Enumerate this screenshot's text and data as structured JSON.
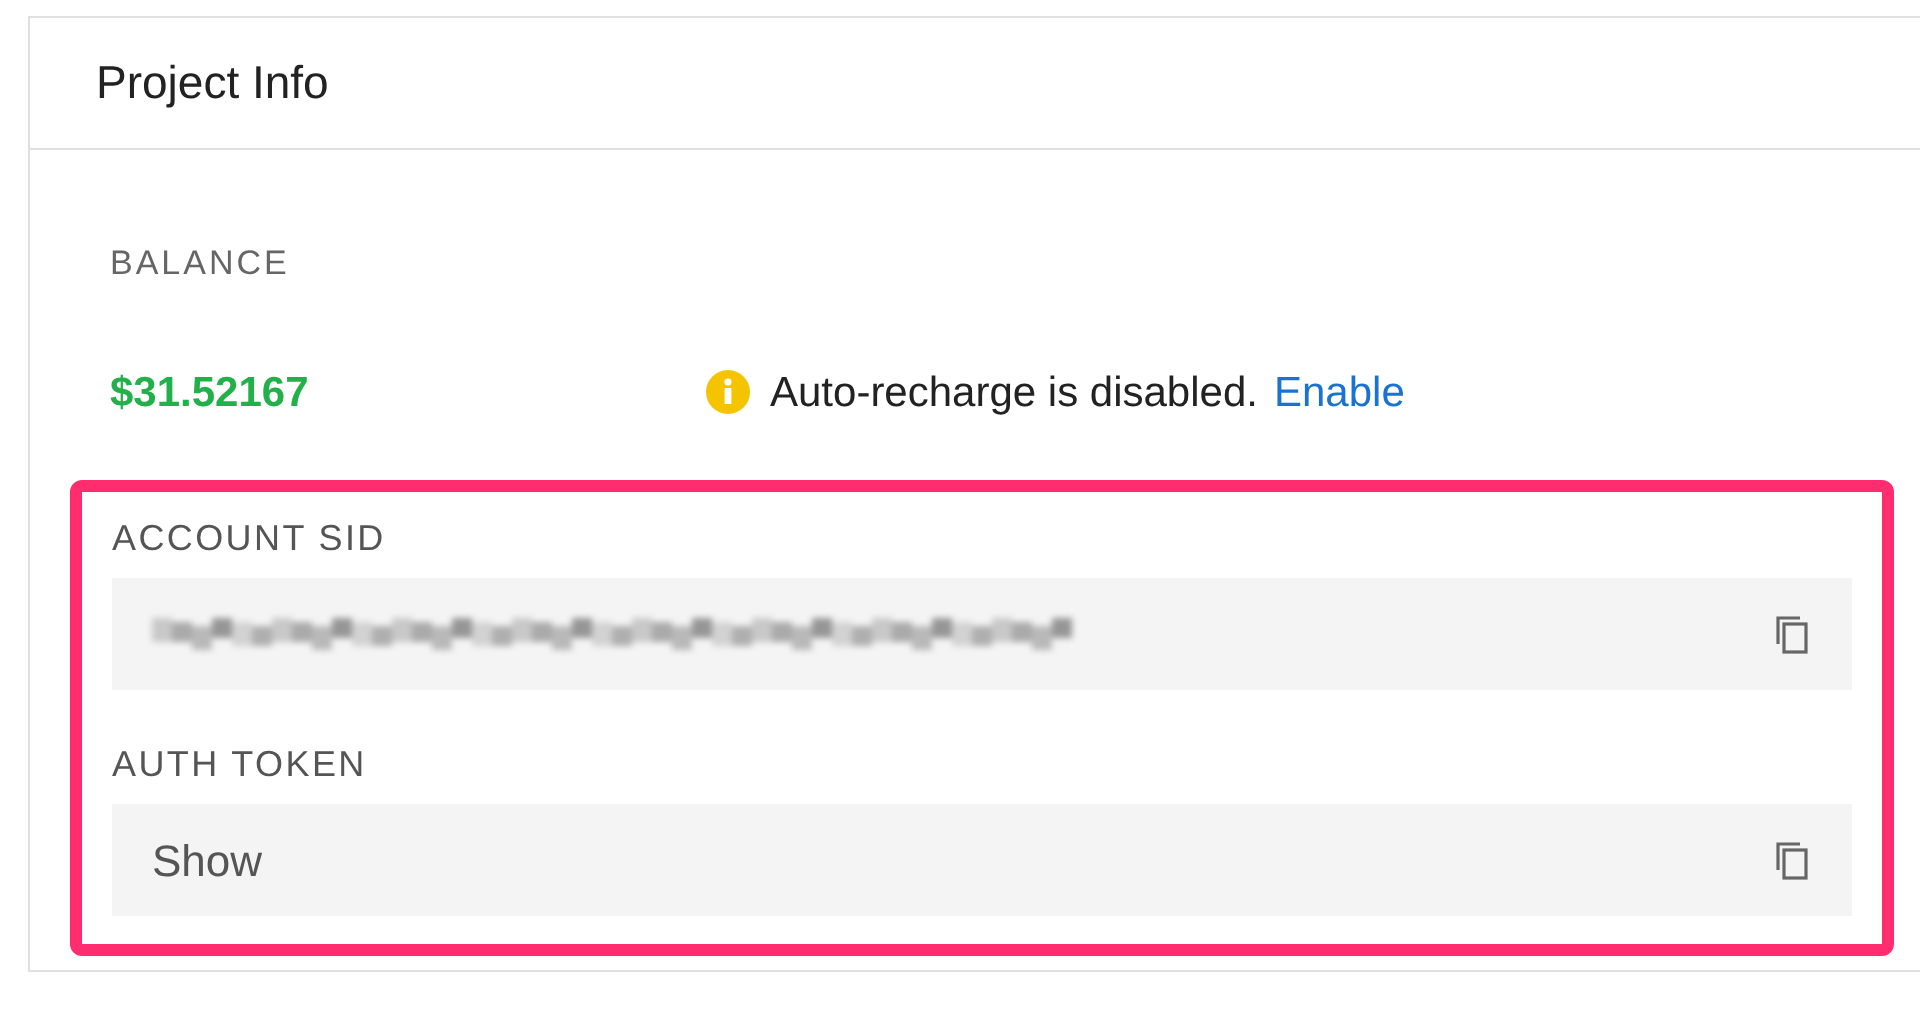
{
  "card": {
    "title": "Project Info"
  },
  "balance": {
    "label": "BALANCE",
    "amount": "$31.52167",
    "notice": "Auto-recharge is disabled.",
    "link": "Enable"
  },
  "highlight": {
    "color": "#ff2d6f"
  },
  "fields": [
    {
      "label": "ACCOUNT SID",
      "kind": "redacted"
    },
    {
      "label": "AUTH TOKEN",
      "kind": "text",
      "value": "Show"
    }
  ]
}
